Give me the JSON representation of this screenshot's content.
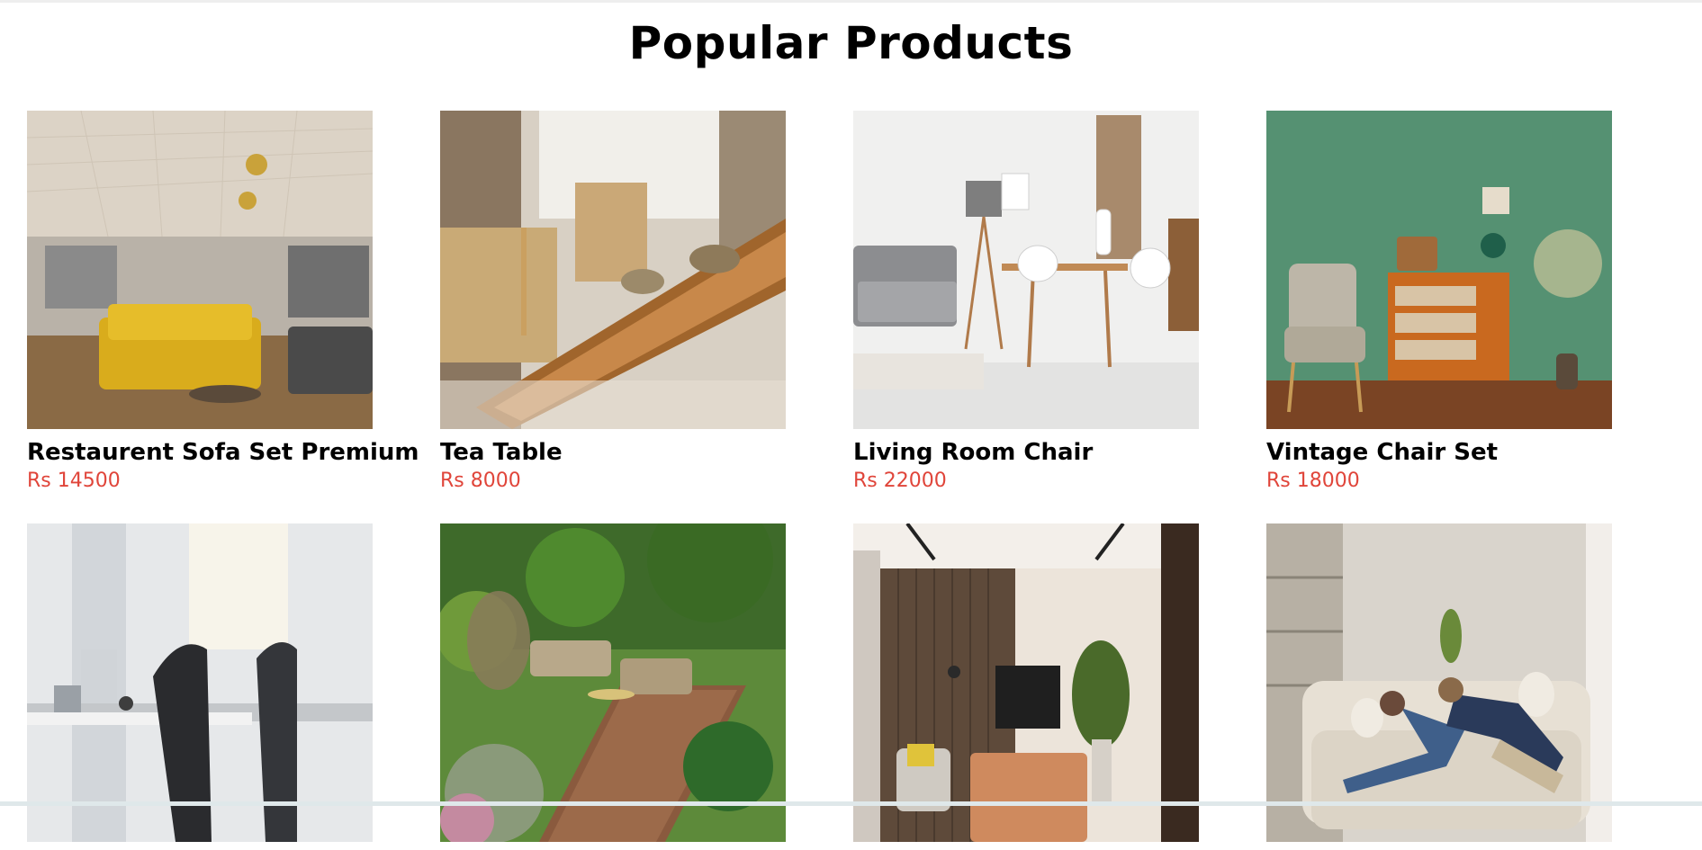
{
  "page": {
    "title": "Popular Products"
  },
  "products": [
    {
      "name": "Restaurent Sofa Set Premium",
      "price": "Rs 14500",
      "image": "showroom-sofa-image"
    },
    {
      "name": "Tea Table",
      "price": "Rs 8000",
      "image": "wooden-table-image"
    },
    {
      "name": "Living Room Chair",
      "price": "Rs 22000",
      "image": "living-room-image"
    },
    {
      "name": "Vintage Chair Set",
      "price": "Rs 18000",
      "image": "vintage-chair-image"
    },
    {
      "name": "",
      "price": "",
      "image": "office-chair-image"
    },
    {
      "name": "",
      "price": "",
      "image": "garden-patio-image"
    },
    {
      "name": "",
      "price": "",
      "image": "tv-lounge-image"
    },
    {
      "name": "",
      "price": "",
      "image": "couple-sofa-image"
    }
  ],
  "colors": {
    "price": "#e0453a",
    "title": "#000000"
  }
}
